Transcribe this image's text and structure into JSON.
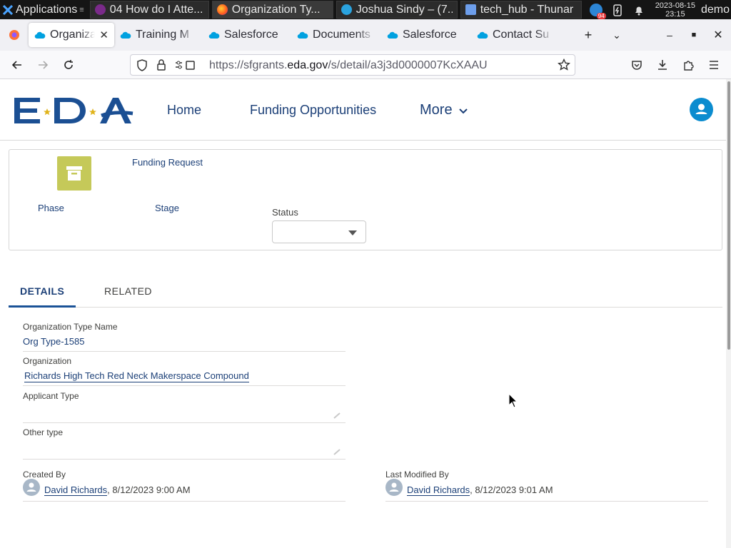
{
  "taskbar": {
    "apps_label": "Applications",
    "tasks": [
      {
        "label": "04 How do I Atte...",
        "icon": "media-player-icon"
      },
      {
        "label": "Organization Ty...",
        "icon": "firefox-icon"
      },
      {
        "label": "Joshua Sindy – (7...",
        "icon": "telegram-icon"
      },
      {
        "label": "tech_hub - Thunar",
        "icon": "folder-icon"
      }
    ],
    "tray_badge": "94",
    "clock_date": "2023-08-15",
    "clock_time": "23:15",
    "user": "demo"
  },
  "browser": {
    "tabs": [
      {
        "label": "Organiza",
        "active": true
      },
      {
        "label": "Training M",
        "active": false
      },
      {
        "label": "Salesforce",
        "active": false
      },
      {
        "label": "Documents",
        "active": false
      },
      {
        "label": "Salesforce",
        "active": false
      },
      {
        "label": "Contact Su",
        "active": false
      }
    ],
    "url_prefix": "https://sfgrants.",
    "url_domain": "eda.gov",
    "url_path": "/s/detail/a3j3d0000007KcXAAU"
  },
  "site": {
    "logo_text": "EDA",
    "nav": {
      "home": "Home",
      "funding": "Funding Opportunities",
      "more": "More"
    }
  },
  "record": {
    "type_label": "Funding Request",
    "phase_label": "Phase",
    "stage_label": "Stage",
    "status_label": "Status",
    "status_value": ""
  },
  "tabs": {
    "details": "DETAILS",
    "related": "RELATED"
  },
  "fields": {
    "org_type_name_label": "Organization Type Name",
    "org_type_name_value": "Org Type-1585",
    "organization_label": "Organization",
    "organization_value": "Richards High Tech Red Neck Makerspace Compound",
    "applicant_type_label": "Applicant Type",
    "applicant_type_value": "",
    "other_type_label": "Other type",
    "other_type_value": "",
    "created_by_label": "Created By",
    "created_by_name": "David Richards",
    "created_by_date": ", 8/12/2023 9:00 AM",
    "modified_by_label": "Last Modified By",
    "modified_by_name": "David Richards",
    "modified_by_date": ", 8/12/2023 9:01 AM"
  },
  "colors": {
    "brand_navy": "#1b3f77",
    "icon_tile": "#c5c959",
    "avatar": "#0b8ccf"
  }
}
